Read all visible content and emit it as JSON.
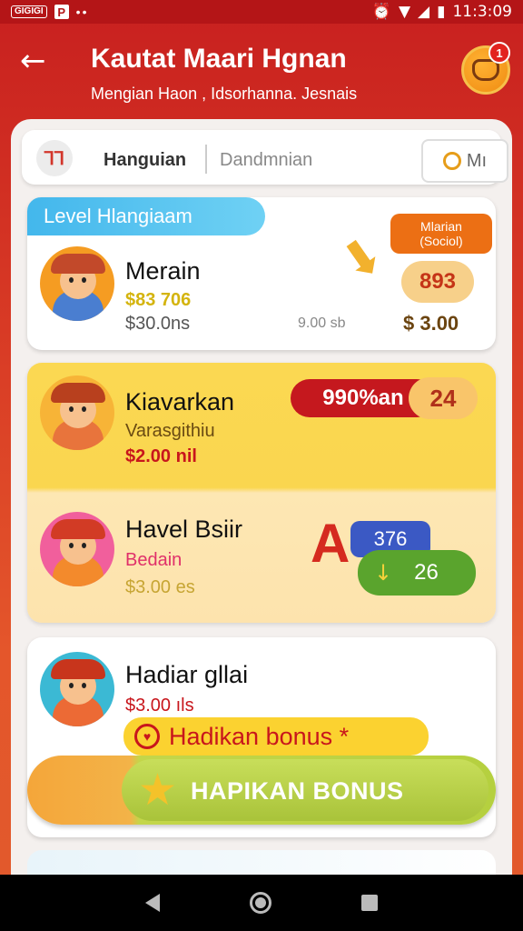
{
  "status_bar": {
    "left_chip": "GIGIGI",
    "app_letter": "P",
    "dots": "••",
    "time": "11:3:09"
  },
  "header": {
    "title": "Kautat Maari Hgnan",
    "subtitle": "Mengian Haon , Idsorhanna. Jesnais",
    "notification_count": "1"
  },
  "topbar": {
    "tab_active": "Hanguian",
    "tab_inactive": "Dandmnian",
    "button_label": "Mı"
  },
  "cards": [
    {
      "level_tag": "Level Hlangiaam",
      "name": "Merain",
      "sub": "$83 706",
      "price": "$30.0ns",
      "mid_value": "9.00 sb",
      "badge_top": "Mlarian (Sociol)",
      "badge_value": "893",
      "right_price": "$ 3.00"
    },
    {
      "name": "Kiavarkan",
      "sub": "Varasgithiu",
      "price": "$2.00 nil",
      "pill_label": "990%an",
      "pill_value": "24"
    },
    {
      "name": "Havel Bsiir",
      "sub": "Bedain",
      "price": "$3.00 es",
      "value_top": "376",
      "value_bottom": "26"
    },
    {
      "name": "Hadiar gllai",
      "price": "$3.00 ıls",
      "bonus_tag": "Hadikan bonus *",
      "bonus_button": "HAPIKAN BONUS"
    }
  ],
  "colors": {
    "header_red": "#c8201f",
    "accent_orange": "#f08c12",
    "accent_yellow": "#fbd230",
    "accent_green": "#a9c33a",
    "price_red": "#c8161c"
  }
}
